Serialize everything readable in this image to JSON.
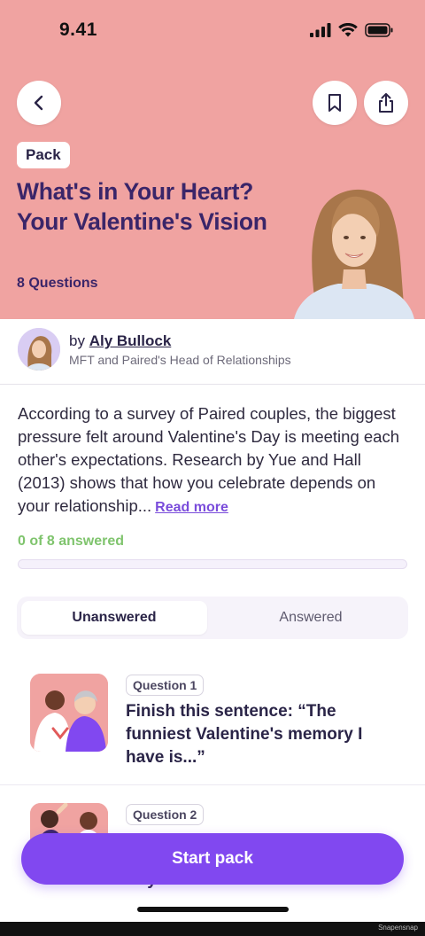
{
  "status_bar": {
    "time": "9.41"
  },
  "header": {
    "badge": "Pack",
    "title": "What's in Your Heart? Your Valentine's Vision",
    "question_count": "8 Questions"
  },
  "author": {
    "prefix": "by",
    "name": "Aly Bullock",
    "role": "MFT and Paired's Head of Relationships"
  },
  "description": {
    "text": "According to a survey of Paired couples, the biggest pressure felt around Valentine's Day is meeting each other's expectations. Research by Yue and Hall (2013) shows that how you celebrate depends on your relationship...",
    "read_more": "Read more"
  },
  "progress": {
    "label": "0 of 8 answered",
    "fraction": 0
  },
  "tabs": [
    {
      "label": "Unanswered",
      "active": true
    },
    {
      "label": "Answered",
      "active": false
    }
  ],
  "questions": [
    {
      "badge": "Question 1",
      "text": "Finish this sentence: “The funniest Valentine's memory I have is...”"
    },
    {
      "badge": "Question 2",
      "text": "Day was...”"
    }
  ],
  "cta": {
    "label": "Start pack"
  },
  "watermark": "Snapensnap",
  "colors": {
    "hero_bg": "#f0a3a1",
    "title": "#3a2569",
    "accent": "#8148f0",
    "progress": "#7fc46d"
  }
}
